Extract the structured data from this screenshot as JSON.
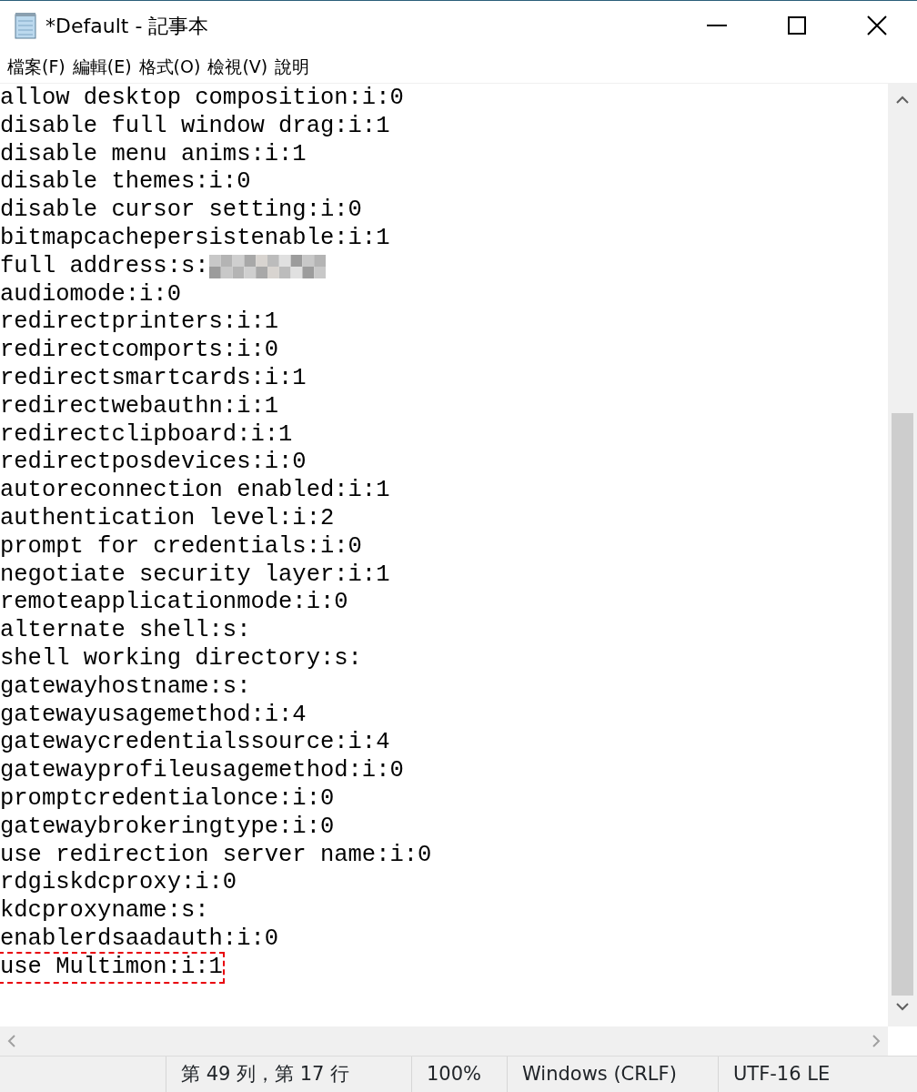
{
  "window": {
    "title": "*Default - 記事本"
  },
  "menu": [
    "檔案(F)",
    "編輯(E)",
    "格式(O)",
    "檢視(V)",
    "說明"
  ],
  "lines": [
    {
      "text": "allow desktop composition:i:0",
      "highlighted": false,
      "redacted": false
    },
    {
      "text": "disable full window drag:i:1",
      "highlighted": false,
      "redacted": false
    },
    {
      "text": "disable menu anims:i:1",
      "highlighted": false,
      "redacted": false
    },
    {
      "text": "disable themes:i:0",
      "highlighted": false,
      "redacted": false
    },
    {
      "text": "disable cursor setting:i:0",
      "highlighted": false,
      "redacted": false
    },
    {
      "text": "bitmapcachepersistenable:i:1",
      "highlighted": false,
      "redacted": false
    },
    {
      "text": "full address:s:",
      "highlighted": false,
      "redacted": true
    },
    {
      "text": "audiomode:i:0",
      "highlighted": false,
      "redacted": false
    },
    {
      "text": "redirectprinters:i:1",
      "highlighted": false,
      "redacted": false
    },
    {
      "text": "redirectcomports:i:0",
      "highlighted": false,
      "redacted": false
    },
    {
      "text": "redirectsmartcards:i:1",
      "highlighted": false,
      "redacted": false
    },
    {
      "text": "redirectwebauthn:i:1",
      "highlighted": false,
      "redacted": false
    },
    {
      "text": "redirectclipboard:i:1",
      "highlighted": false,
      "redacted": false
    },
    {
      "text": "redirectposdevices:i:0",
      "highlighted": false,
      "redacted": false
    },
    {
      "text": "autoreconnection enabled:i:1",
      "highlighted": false,
      "redacted": false
    },
    {
      "text": "authentication level:i:2",
      "highlighted": false,
      "redacted": false
    },
    {
      "text": "prompt for credentials:i:0",
      "highlighted": false,
      "redacted": false
    },
    {
      "text": "negotiate security layer:i:1",
      "highlighted": false,
      "redacted": false
    },
    {
      "text": "remoteapplicationmode:i:0",
      "highlighted": false,
      "redacted": false
    },
    {
      "text": "alternate shell:s:",
      "highlighted": false,
      "redacted": false
    },
    {
      "text": "shell working directory:s:",
      "highlighted": false,
      "redacted": false
    },
    {
      "text": "gatewayhostname:s:",
      "highlighted": false,
      "redacted": false
    },
    {
      "text": "gatewayusagemethod:i:4",
      "highlighted": false,
      "redacted": false
    },
    {
      "text": "gatewaycredentialssource:i:4",
      "highlighted": false,
      "redacted": false
    },
    {
      "text": "gatewayprofileusagemethod:i:0",
      "highlighted": false,
      "redacted": false
    },
    {
      "text": "promptcredentialonce:i:0",
      "highlighted": false,
      "redacted": false
    },
    {
      "text": "gatewaybrokeringtype:i:0",
      "highlighted": false,
      "redacted": false
    },
    {
      "text": "use redirection server name:i:0",
      "highlighted": false,
      "redacted": false
    },
    {
      "text": "rdgiskdcproxy:i:0",
      "highlighted": false,
      "redacted": false
    },
    {
      "text": "kdcproxyname:s:",
      "highlighted": false,
      "redacted": false
    },
    {
      "text": "enablerdsaadauth:i:0",
      "highlighted": false,
      "redacted": false
    },
    {
      "text": "use Multimon:i:1",
      "highlighted": true,
      "redacted": false
    }
  ],
  "status_bar": {
    "position": "第 49 列，第 17 行",
    "zoom": "100%",
    "line_ending": "Windows (CRLF)",
    "encoding": "UTF-16 LE"
  }
}
